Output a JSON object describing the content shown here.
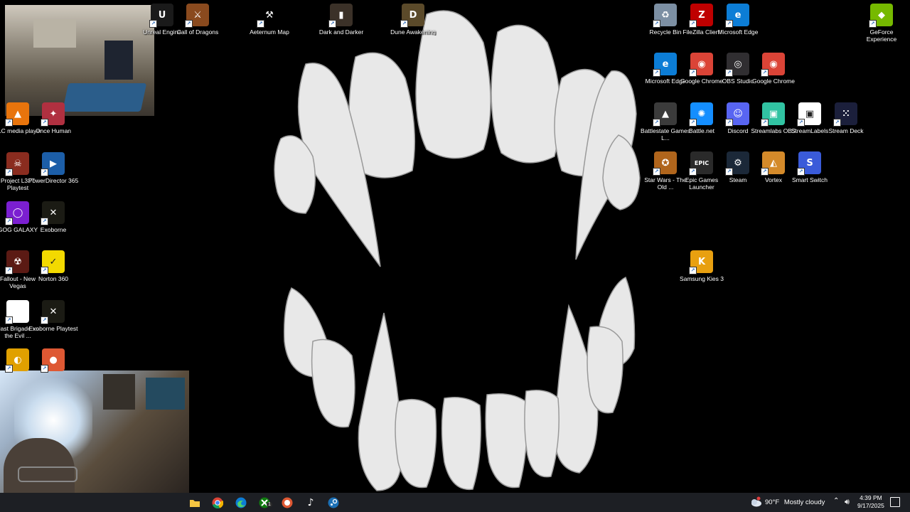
{
  "desktop": {
    "icons_left": [
      {
        "label": "Unreal Engine",
        "icon": "unreal-engine-icon",
        "color": "#1a1a1a"
      },
      {
        "label": "Call of Dragons",
        "icon": "call-of-dragons-icon",
        "color": "#8a4a1e"
      },
      {
        "label": "Aeternum Map",
        "icon": "aeternum-map-icon",
        "color": "#000000"
      },
      {
        "label": "Dark and Darker",
        "icon": "dark-and-darker-icon",
        "color": "#3b3128"
      },
      {
        "label": "Dune Awakening",
        "icon": "dune-awakening-icon",
        "color": "#5b4a2a"
      },
      {
        "label": "VLC media player",
        "icon": "vlc-icon",
        "color": "#e8740c"
      },
      {
        "label": "Once Human",
        "icon": "once-human-icon",
        "color": "#b03040"
      },
      {
        "label": "Project L33T Playtest",
        "icon": "project-l33t-icon",
        "color": "#8a2c1f"
      },
      {
        "label": "PowerDirector 365",
        "icon": "powerdirector-icon",
        "color": "#1c5ea8"
      },
      {
        "label": "GOG GALAXY",
        "icon": "gog-galaxy-icon",
        "color": "#7b1fd1"
      },
      {
        "label": "Exoborne",
        "icon": "exoborne-icon",
        "color": "#1b1b14"
      },
      {
        "label": "Fallout - New Vegas",
        "icon": "fallout-new-vegas-icon",
        "color": "#5b1a14"
      },
      {
        "label": "Norton 360",
        "icon": "norton-360-icon",
        "color": "#f2d900"
      },
      {
        "label": "Blast Brigade vs. the Evil ...",
        "icon": "file-icon",
        "color": "#ffffff"
      },
      {
        "label": "Exoborne Playtest",
        "icon": "exoborne-playtest-icon",
        "color": "#1b1b14"
      },
      {
        "label": "",
        "icon": "cyberlink-icon",
        "color": "#e0a000"
      },
      {
        "label": "",
        "icon": "duckduckgo-icon",
        "color": "#de5833"
      }
    ],
    "icons_right": [
      {
        "label": "Recycle Bin",
        "icon": "recycle-bin-icon",
        "color": "#7c8fa3"
      },
      {
        "label": "FileZilla Client",
        "icon": "filezilla-icon",
        "color": "#bf0000"
      },
      {
        "label": "Microsoft Edge",
        "icon": "edge-icon",
        "color": "#0c7dd6"
      },
      {
        "label": "GeForce Experience",
        "icon": "geforce-icon",
        "color": "#76b900"
      },
      {
        "label": "Microsoft Edge",
        "icon": "edge-icon",
        "color": "#0c7dd6"
      },
      {
        "label": "Google Chrome",
        "icon": "chrome-icon",
        "color": "#db4437"
      },
      {
        "label": "OBS Studio",
        "icon": "obs-icon",
        "color": "#302e31"
      },
      {
        "label": "Google Chrome",
        "icon": "chrome-icon",
        "color": "#db4437"
      },
      {
        "label": "Battlestate Games L...",
        "icon": "battlestate-icon",
        "color": "#3b3b3b"
      },
      {
        "label": "Battle.net",
        "icon": "battlenet-icon",
        "color": "#148eff"
      },
      {
        "label": "Discord",
        "icon": "discord-icon",
        "color": "#5865f2"
      },
      {
        "label": "Streamlabs OBS",
        "icon": "streamlabs-icon",
        "color": "#31c3a2"
      },
      {
        "label": "StreamLabels",
        "icon": "streamlabels-icon",
        "color": "#ffffff"
      },
      {
        "label": "Stream Deck",
        "icon": "stream-deck-icon",
        "color": "#1b1f3b"
      },
      {
        "label": "Star Wars - The Old ...",
        "icon": "star-wars-icon",
        "color": "#b0651c"
      },
      {
        "label": "Epic Games Launcher",
        "icon": "epic-games-icon",
        "color": "#2a2a2a"
      },
      {
        "label": "Steam",
        "icon": "steam-icon",
        "color": "#1b2838"
      },
      {
        "label": "Vortex",
        "icon": "vortex-icon",
        "color": "#d48a2a"
      },
      {
        "label": "Smart Switch",
        "icon": "smart-switch-icon",
        "color": "#3a5bd9"
      },
      {
        "label": "Samsung Kies 3",
        "icon": "samsung-kies-icon",
        "color": "#e8a010"
      }
    ]
  },
  "taskbar": {
    "apps": [
      "file-explorer-icon",
      "chrome-icon",
      "edge-icon",
      "xbox-icon",
      "duckduckgo-icon",
      "tiktok-icon",
      "steam-icon"
    ],
    "xbox_badge": "1",
    "weather": {
      "temp": "90°F",
      "condition": "Mostly cloudy"
    },
    "time": "4:39 PM",
    "date": "9/17/2025"
  },
  "glyphs": {
    "unreal": "U",
    "call": "⚔",
    "aeternum": "⚒",
    "dark": "▮",
    "dune": "D",
    "vlc": "▲",
    "once": "✦",
    "l33t": "☠",
    "power": "▶",
    "gog": "◯",
    "exo": "✕",
    "fnv": "☢",
    "norton": "✓",
    "file": "",
    "cyber": "◐",
    "duck": "●",
    "recycle": "♻",
    "filezilla": "Z",
    "edge": "e",
    "geforce": "◆",
    "chrome": "◉",
    "obs": "◎",
    "battlestate": "▲",
    "battlenet": "✺",
    "discord": "☺",
    "streamlabs": "▣",
    "streamlabels": "▣",
    "streamdeck": "⁙",
    "swtor": "✪",
    "epic": "EPIC",
    "steam": "⚙",
    "vortex": "◭",
    "smartswitch": "S",
    "kies": "K"
  }
}
